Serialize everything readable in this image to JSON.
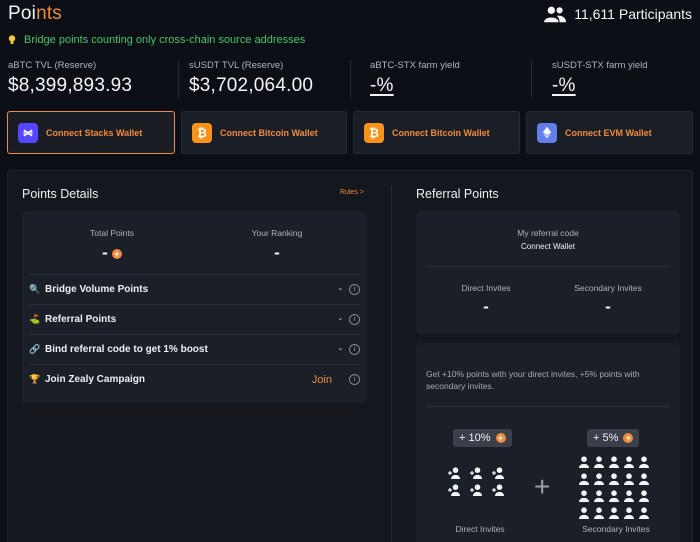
{
  "header": {
    "title_main": "Poi",
    "title_accent": "nts",
    "participants": "11,611 Participants"
  },
  "notice": "Bridge points counting only cross-chain source addresses",
  "stats": [
    {
      "label": "aBTC TVL (Reserve)",
      "value": "$8,399,893.93"
    },
    {
      "label": "sUSDT TVL (Reserve)",
      "value": "$3,702,064.00"
    },
    {
      "label": "aBTC-STX farm yield",
      "value": "-%"
    },
    {
      "label": "sUSDT-STX farm yield",
      "value": "-%"
    }
  ],
  "wallets": [
    {
      "label": "Connect Stacks Wallet",
      "icon": "stacks-icon",
      "color": "#5546ff"
    },
    {
      "label": "Connect Bitcoin Wallet",
      "icon": "bitcoin-icon",
      "color": "#f7931a"
    },
    {
      "label": "Connect Bitcoin Wallet",
      "icon": "bitcoin-icon",
      "color": "#f7931a"
    },
    {
      "label": "Connect EVM Wallet",
      "icon": "ethereum-icon",
      "color": "#627eea"
    }
  ],
  "points_details": {
    "title": "Points Details",
    "rules_link": "Rules >",
    "total_points_label": "Total Points",
    "total_points_value": "-",
    "ranking_label": "Your Ranking",
    "ranking_value": "-",
    "rows": [
      {
        "label": "Bridge Volume Points",
        "value": "-",
        "icon": "magnifier-icon"
      },
      {
        "label": "Referral Points",
        "value": "-",
        "icon": "flag-icon"
      },
      {
        "label": "Bind referral code to get 1% boost",
        "value": "-",
        "icon": "link-icon"
      },
      {
        "label": "Join Zealy Campaign",
        "value": "Join",
        "icon": "trophy-icon"
      }
    ]
  },
  "referral": {
    "title": "Referral Points",
    "code_label": "My referral code",
    "code_value": "Connect Wallet",
    "direct_label": "Direct Invites",
    "direct_value": "-",
    "secondary_label": "Secondary Invites",
    "secondary_value": "-",
    "description": "Get +10% points with your direct invites, +5% points with secondary invites.",
    "direct_bonus": "+ 10%",
    "secondary_bonus": "+ 5%",
    "plus_sign": "+",
    "direct_caption": "Direct Invites",
    "secondary_caption": "Secondary Invites"
  },
  "colors": {
    "accent": "#f08a3c",
    "notice_green": "#45c56e",
    "background": "#0c0f16"
  }
}
